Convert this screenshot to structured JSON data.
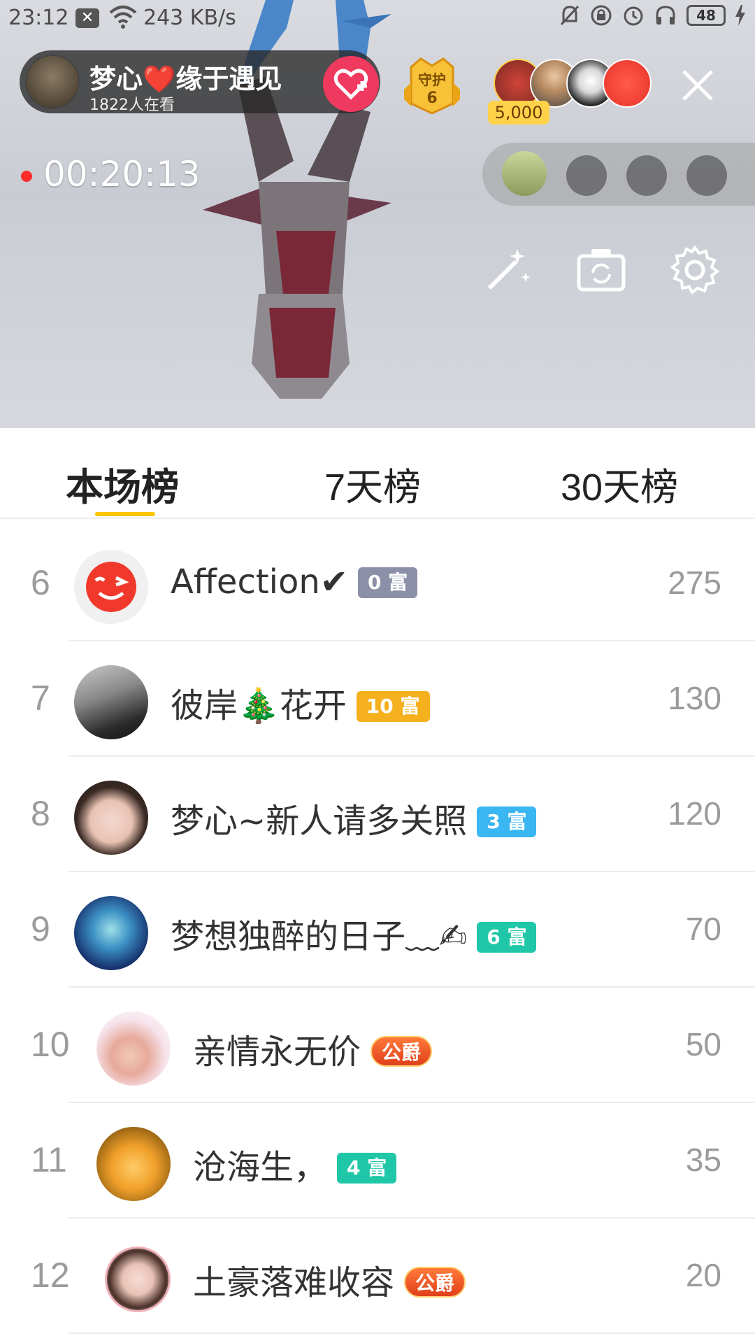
{
  "status_bar": {
    "time": "23:12",
    "network_speed": "243 KB/s",
    "battery": "48"
  },
  "host": {
    "name": "梦心❤️缘于遇见",
    "viewers": "1822人在看"
  },
  "guard": {
    "label": "守护",
    "count": "6"
  },
  "top_viewers": {
    "coins": "5,000"
  },
  "live_timer": "00:20:13",
  "tabs": [
    {
      "label": "本场榜"
    },
    {
      "label": "7天榜"
    },
    {
      "label": "30天榜"
    }
  ],
  "ranking": [
    {
      "rank": "6",
      "name": "Affection✔",
      "badge": "0 富",
      "badge_color": "#8b90a8",
      "score": "275"
    },
    {
      "rank": "7",
      "name": "彼岸🎄花开",
      "badge": "10 富",
      "badge_color": "#f5b01e",
      "score": "130"
    },
    {
      "rank": "8",
      "name": "梦心~新人请多关照",
      "badge": "3 富",
      "badge_color": "#3ab6f2",
      "score": "120"
    },
    {
      "rank": "9",
      "name": "梦想独醉的日子﹏✍",
      "badge": "6 富",
      "badge_color": "#1fc7a8",
      "score": "70"
    },
    {
      "rank": "10",
      "name": "亲情永无价",
      "badge": "公爵",
      "badge_color": "#ee5422",
      "score": "50"
    },
    {
      "rank": "11",
      "name": "沧海生，",
      "badge": "4 富",
      "badge_color": "#1fc7a8",
      "score": "35"
    },
    {
      "rank": "12",
      "name": "土豪落难收容",
      "badge": "公爵",
      "badge_color": "#ee5422",
      "score": "20"
    }
  ]
}
